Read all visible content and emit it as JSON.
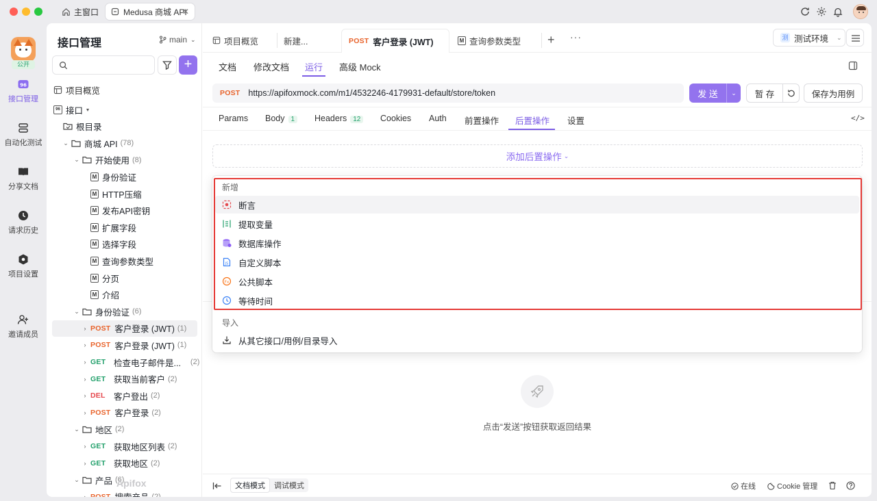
{
  "window": {
    "tabs": [
      {
        "label": "主窗口"
      },
      {
        "label": "Medusa 商城 API"
      }
    ]
  },
  "rail": {
    "badge": "公开",
    "items": [
      {
        "label": "接口管理"
      },
      {
        "label": "自动化测试"
      },
      {
        "label": "分享文档"
      },
      {
        "label": "请求历史"
      },
      {
        "label": "项目设置"
      },
      {
        "label": "邀请成员"
      }
    ]
  },
  "sidebar": {
    "title": "接口管理",
    "branch": "main",
    "search_placeholder": "",
    "overview": "项目概览",
    "tree": [
      {
        "label": "接口",
        "type": "group",
        "caret": "▾"
      },
      {
        "label": "根目录",
        "type": "root"
      },
      {
        "label": "商城 API",
        "count": "(78)",
        "type": "folder"
      },
      {
        "label": "开始使用",
        "count": "(8)",
        "type": "folder"
      },
      {
        "label": "身份验证",
        "type": "doc"
      },
      {
        "label": "HTTP压缩",
        "type": "doc"
      },
      {
        "label": "发布API密钥",
        "type": "doc"
      },
      {
        "label": "扩展字段",
        "type": "doc"
      },
      {
        "label": "选择字段",
        "type": "doc"
      },
      {
        "label": "查询参数类型",
        "type": "doc"
      },
      {
        "label": "分页",
        "type": "doc"
      },
      {
        "label": "介绍",
        "type": "doc"
      },
      {
        "label": "身份验证",
        "count": "(6)",
        "type": "folder"
      },
      {
        "method": "POST",
        "label": "客户登录 (JWT)",
        "count": "(1)",
        "type": "api"
      },
      {
        "method": "POST",
        "label": "客户登录 (JWT)",
        "count": "(1)",
        "type": "api"
      },
      {
        "method": "GET",
        "label": "检查电子邮件是...",
        "count": "(2)",
        "type": "api"
      },
      {
        "method": "GET",
        "label": "获取当前客户",
        "count": "(2)",
        "type": "api"
      },
      {
        "method": "DEL",
        "label": "客户登出",
        "count": "(2)",
        "type": "api"
      },
      {
        "method": "POST",
        "label": "客户登录",
        "count": "(2)",
        "type": "api"
      },
      {
        "label": "地区",
        "count": "(2)",
        "type": "folder"
      },
      {
        "method": "GET",
        "label": "获取地区列表",
        "count": "(2)",
        "type": "api"
      },
      {
        "method": "GET",
        "label": "获取地区",
        "count": "(2)",
        "type": "api"
      },
      {
        "label": "产品",
        "count": "(6)",
        "type": "folder"
      },
      {
        "method": "POST",
        "label": "搜索产品",
        "count": "(2)",
        "type": "api"
      }
    ],
    "watermark": "Apifox"
  },
  "main": {
    "doc_tabs": [
      {
        "label": "项目概览"
      },
      {
        "label": "新建..."
      },
      {
        "method": "POST",
        "label": "客户登录 (JWT)"
      },
      {
        "label": "查询参数类型"
      }
    ],
    "env_label": "测试环境",
    "env_icon_text": "测",
    "subtabs": [
      {
        "label": "文档"
      },
      {
        "label": "修改文档"
      },
      {
        "label": "运行"
      },
      {
        "label": "高级 Mock"
      }
    ],
    "url_method": "POST",
    "url": "https://apifoxmock.com/m1/4532246-4179931-default/store/token",
    "send_label": "发 送",
    "save_temp_label": "暂 存",
    "save_example_label": "保存为用例",
    "param_tabs": [
      {
        "label": "Params"
      },
      {
        "label": "Body",
        "badge": "1"
      },
      {
        "label": "Headers",
        "badge": "12"
      },
      {
        "label": "Cookies"
      },
      {
        "label": "Auth"
      },
      {
        "label": "前置操作"
      },
      {
        "label": "后置操作"
      },
      {
        "label": "设置"
      }
    ],
    "add_post_label": "添加后置操作",
    "menu": {
      "group_new": "新增",
      "new_items": [
        {
          "label": "断言",
          "icon": "assert-icon",
          "color": "#e5484d"
        },
        {
          "label": "提取变量",
          "icon": "extract-variable-icon",
          "color": "#22a06b"
        },
        {
          "label": "数据库操作",
          "icon": "database-icon",
          "color": "#8b5cf6"
        },
        {
          "label": "自定义脚本",
          "icon": "script-icon",
          "color": "#3b82f6"
        },
        {
          "label": "公共脚本",
          "icon": "public-script-icon",
          "color": "#f97316"
        },
        {
          "label": "等待时间",
          "icon": "clock-icon",
          "color": "#3b82f6"
        }
      ],
      "group_import": "导入",
      "import_items": [
        {
          "label": "从其它接口/用例/目录导入",
          "icon": "import-icon"
        }
      ]
    },
    "empty_text": "点击“发送”按钮获取返回结果",
    "footer": {
      "mode_doc": "文档模式",
      "mode_debug": "调试模式",
      "online": "在线",
      "cookie": "Cookie 管理"
    }
  },
  "colors": {
    "accent": "#9373ee",
    "post": "#e8632b",
    "get": "#22a06b",
    "del": "#e5484d",
    "highlight": "#e53935"
  }
}
